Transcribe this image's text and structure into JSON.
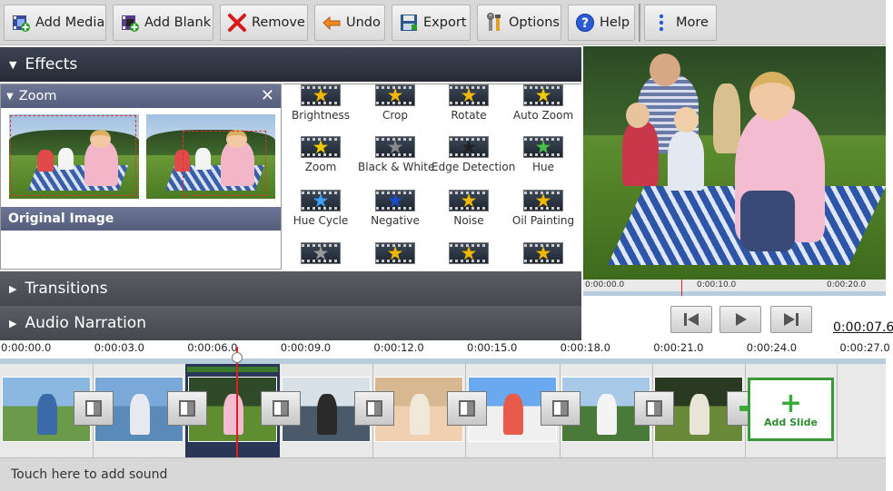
{
  "toolbar": {
    "buttons": [
      {
        "label": "Add Media",
        "icon": "film-plus-icon"
      },
      {
        "label": "Add Blank",
        "icon": "blank-plus-icon"
      },
      {
        "label": "Remove",
        "icon": "x-icon"
      },
      {
        "label": "Undo",
        "icon": "undo-arrow-icon"
      },
      {
        "label": "Export",
        "icon": "save-icon"
      },
      {
        "label": "Options",
        "icon": "tools-icon"
      },
      {
        "label": "Help",
        "icon": "question-icon"
      },
      {
        "label": "More",
        "icon": "overflow-dots-icon"
      }
    ]
  },
  "panels": {
    "effects": "Effects",
    "transitions": "Transitions",
    "audio": "Audio Narration"
  },
  "zoom": {
    "title": "Zoom",
    "close": "✕",
    "original_label": "Original Image"
  },
  "effects": [
    {
      "label": "Brightness",
      "star": "#f2b800"
    },
    {
      "label": "Crop",
      "star": "#f2b800"
    },
    {
      "label": "Rotate",
      "star": "#f2b800"
    },
    {
      "label": "Auto Zoom",
      "star": "#f2c800"
    },
    {
      "label": "Zoom",
      "star": "#f2c800"
    },
    {
      "label": "Black & White",
      "star": "#8a8a8a"
    },
    {
      "label": "Edge Detection",
      "star": "#222222"
    },
    {
      "label": "Hue",
      "star": "#48c048"
    },
    {
      "label": "Hue Cycle",
      "star": "#40a0ff"
    },
    {
      "label": "Negative",
      "star": "#1a4acf"
    },
    {
      "label": "Noise",
      "star": "#f2b800"
    },
    {
      "label": "Oil Painting",
      "star": "#f2b800"
    },
    {
      "label": "",
      "star": "#9a9a9a"
    },
    {
      "label": "",
      "star": "#f2b800"
    },
    {
      "label": "",
      "star": "#f2b800"
    },
    {
      "label": "",
      "star": "#f2b800"
    }
  ],
  "preview": {
    "scale": [
      "0:00:00.0",
      "0:00:10.0",
      "0:00:20.0"
    ],
    "time": "0:00:07.6"
  },
  "timeline": {
    "ticks": [
      "0:00:00.0",
      "0:00:03.0",
      "0:00:06.0",
      "0:00:09.0",
      "0:00:12.0",
      "0:00:15.0",
      "0:00:18.0",
      "0:00:21.0",
      "0:00:24.0",
      "0:00:27.0"
    ],
    "add_slide": "Add Slide"
  },
  "sound": {
    "hint": "Touch here to add sound"
  },
  "colors": {
    "accent_green": "#3a9a3a",
    "playhead_red": "#e02020",
    "header_dark": "#262b36"
  }
}
